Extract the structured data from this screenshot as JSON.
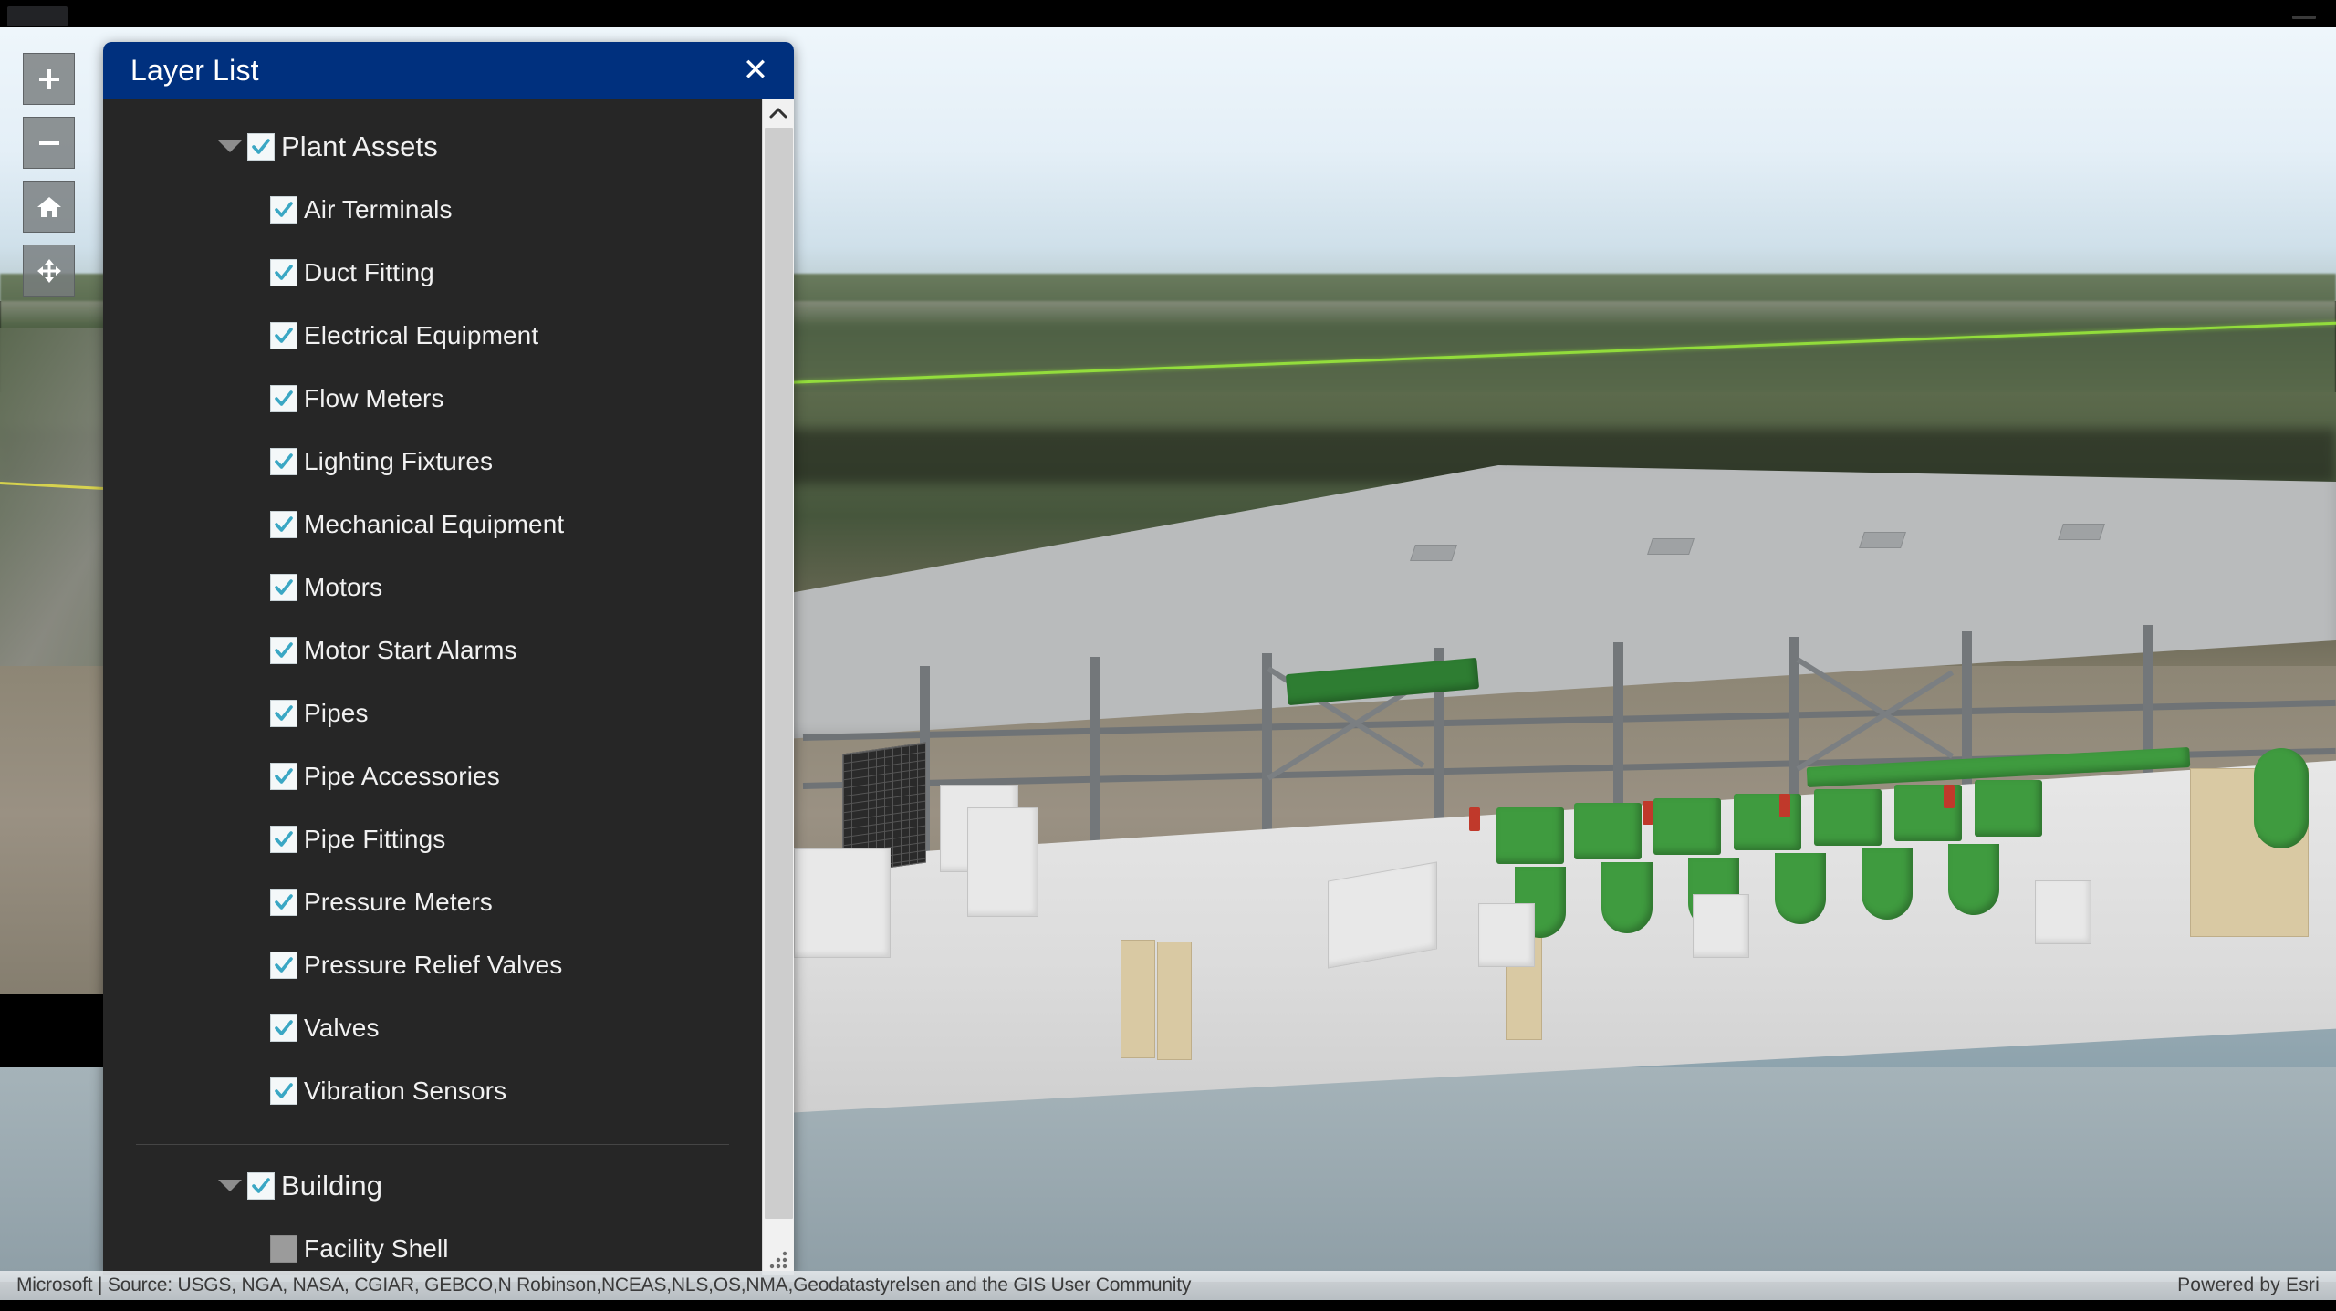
{
  "window": {
    "minimize_icon": "minimize-icon",
    "tab_icon": "browser-tab"
  },
  "map_tools": [
    {
      "name": "zoom-in",
      "icon": "plus-icon",
      "label": "Zoom In"
    },
    {
      "name": "zoom-out",
      "icon": "minus-icon",
      "label": "Zoom Out"
    },
    {
      "name": "home",
      "icon": "home-icon",
      "label": "Default Extent"
    },
    {
      "name": "pan",
      "icon": "pan-arrows-icon",
      "label": "Pan"
    }
  ],
  "panel": {
    "title": "Layer List",
    "close_label": "✕",
    "header_color": "#00307e",
    "body_color": "#262626",
    "check_color": "#3aa7c4"
  },
  "layers": [
    {
      "id": "plant-assets",
      "label": "Plant Assets",
      "type": "group",
      "checked": true,
      "expanded": true,
      "children": [
        {
          "label": "Air Terminals",
          "checked": true
        },
        {
          "label": "Duct Fitting",
          "checked": true
        },
        {
          "label": "Electrical Equipment",
          "checked": true
        },
        {
          "label": "Flow Meters",
          "checked": true
        },
        {
          "label": "Lighting Fixtures",
          "checked": true
        },
        {
          "label": "Mechanical Equipment",
          "checked": true
        },
        {
          "label": "Motors",
          "checked": true
        },
        {
          "label": "Motor Start Alarms",
          "checked": true
        },
        {
          "label": "Pipes",
          "checked": true
        },
        {
          "label": "Pipe Accessories",
          "checked": true
        },
        {
          "label": "Pipe Fittings",
          "checked": true
        },
        {
          "label": "Pressure Meters",
          "checked": true
        },
        {
          "label": "Pressure Relief Valves",
          "checked": true
        },
        {
          "label": "Valves",
          "checked": true
        },
        {
          "label": "Vibration Sensors",
          "checked": true
        }
      ]
    },
    {
      "id": "building",
      "label": "Building",
      "type": "group",
      "checked": true,
      "expanded": true,
      "children": [
        {
          "label": "Facility Shell",
          "checked": false
        }
      ]
    }
  ],
  "scrollbar": {
    "up_arrow_icon": "chevron-up-icon",
    "resize_grip_icon": "resize-grip-icon"
  },
  "attribution": {
    "text": "Microsoft | Source: USGS, NGA, NASA, CGIAR, GEBCO,N Robinson,NCEAS,NLS,OS,NMA,Geodatastyrelsen and the GIS User Community",
    "powered_by": "Powered by Esri"
  }
}
